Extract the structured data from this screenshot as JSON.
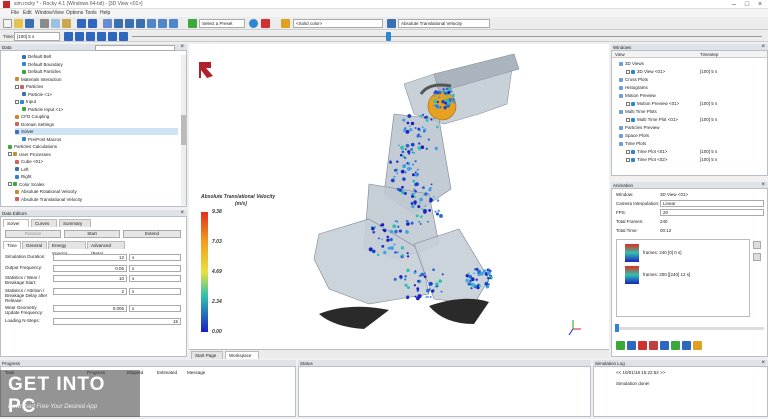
{
  "titlebar": {
    "title": "sim.rocky * - Rocky 4.1 (Windows 64-bit) - [3D View <01>]"
  },
  "menu": [
    "File",
    "Edit",
    "Window",
    "View",
    "Options",
    "Tools",
    "Help"
  ],
  "toolbar": {
    "preset_select": "Select a Preset",
    "color_select": "<Solid color>",
    "property_select": "Absolute Translational Velocity",
    "time_label": "Time:",
    "time_value": "[100] 5 s"
  },
  "data_panel": {
    "title": "Data",
    "tree": [
      {
        "label": "Default Belt",
        "indent": 3,
        "check": false
      },
      {
        "label": "Default Boundary",
        "indent": 3,
        "check": false
      },
      {
        "label": "Default Particles",
        "indent": 3,
        "check": false
      },
      {
        "label": "Materials Interaction",
        "indent": 2,
        "check": false
      },
      {
        "label": "Particles",
        "indent": 2,
        "check": true
      },
      {
        "label": "Particle <1>",
        "indent": 3,
        "check": false
      },
      {
        "label": "Input",
        "indent": 2,
        "check": true
      },
      {
        "label": "Particle Input <1>",
        "indent": 3,
        "check": false
      },
      {
        "label": "CFD Coupling",
        "indent": 2,
        "check": false
      },
      {
        "label": "Domain Settings",
        "indent": 2,
        "check": false
      },
      {
        "label": "Solver",
        "indent": 2,
        "check": false,
        "selected": true
      },
      {
        "label": "Pre/Post Macros",
        "indent": 3,
        "check": false
      },
      {
        "label": "Particles Calculations",
        "indent": 1,
        "check": false
      },
      {
        "label": "User Processes",
        "indent": 1,
        "check": true
      },
      {
        "label": "Cube <01>",
        "indent": 2,
        "check": false
      },
      {
        "label": "Left",
        "indent": 2,
        "check": false
      },
      {
        "label": "Right",
        "indent": 2,
        "check": false
      },
      {
        "label": "Color Scales",
        "indent": 1,
        "check": true
      },
      {
        "label": "Absolute Rotational Velocity",
        "indent": 2,
        "check": false
      },
      {
        "label": "Absolute Translational Velocity",
        "indent": 2,
        "check": false
      }
    ]
  },
  "data_editors": {
    "title": "Data Editors",
    "tabs": [
      "Solver",
      "Curves",
      "Summary"
    ],
    "buttons": [
      "Release",
      "Start",
      "Extend"
    ],
    "subtabs": [
      "Time",
      "General",
      "Energy Spectra",
      "Advanced (Beta)"
    ],
    "fields": [
      {
        "label": "Simulation Duration:",
        "value": "12",
        "unit": "s"
      },
      {
        "label": "Output Frequency:",
        "value": "0.05",
        "unit": "s"
      },
      {
        "label": "Statistics / Wear / Breakage Start:",
        "value": "10",
        "unit": "s"
      },
      {
        "label": "Statistics / Attrition / Breakage Delay after Release:",
        "value": "2",
        "unit": "s"
      },
      {
        "label": "Wear Geometry Update Frequency:",
        "value": "0.005",
        "unit": "s"
      },
      {
        "label": "Loading N-Steps:",
        "value": "15",
        "unit": ""
      }
    ]
  },
  "viewport": {
    "legend_title": "Absolute Translational Velocity",
    "legend_unit": "(m/s)",
    "legend_ticks": [
      "9.38",
      "7.03",
      "4.69",
      "2.34",
      "0.00"
    ],
    "tabs": [
      "Start Page",
      "Workspace"
    ]
  },
  "windows_panel": {
    "title": "Windows",
    "col_view": "View",
    "col_timestep": "Timestep",
    "rows": [
      {
        "label": "3D Views",
        "indent": 1,
        "time": ""
      },
      {
        "label": "3D View <01>",
        "indent": 2,
        "time": "[100] 5 s"
      },
      {
        "label": "Cross Plots",
        "indent": 1,
        "time": ""
      },
      {
        "label": "Histograms",
        "indent": 1,
        "time": ""
      },
      {
        "label": "Motion Preview",
        "indent": 1,
        "time": ""
      },
      {
        "label": "Motion Preview <01>",
        "indent": 2,
        "time": "[100] 5 s"
      },
      {
        "label": "Multi Time Plots",
        "indent": 1,
        "time": ""
      },
      {
        "label": "Multi Time Plot <01>",
        "indent": 2,
        "time": "[100] 5 s"
      },
      {
        "label": "Particles Preview",
        "indent": 1,
        "time": ""
      },
      {
        "label": "Space Plots",
        "indent": 1,
        "time": ""
      },
      {
        "label": "Time Plots",
        "indent": 1,
        "time": ""
      },
      {
        "label": "Time Plot <01>",
        "indent": 2,
        "time": "[100] 5 s"
      },
      {
        "label": "Time Plot <02>",
        "indent": 2,
        "time": "[100] 5 s"
      }
    ]
  },
  "animation_panel": {
    "title": "Animation",
    "fields": [
      {
        "label": "Window:",
        "value": "3D View <01>"
      },
      {
        "label": "Camera Interpolation:",
        "value": "Linear"
      },
      {
        "label": "FPS:",
        "value": "20"
      },
      {
        "label": "Total Frames:",
        "value": "240"
      },
      {
        "label": "Total Time:",
        "value": "00:12"
      }
    ],
    "keyframes": [
      "frames: 240 [0] 0 s]",
      "frames: 200 [[240] 12 s]"
    ]
  },
  "progress_panel": {
    "title": "Progress",
    "cols": [
      "Task",
      "Progress",
      "Elapsed",
      "Estimated",
      "Message"
    ]
  },
  "status_panel": {
    "title": "Status"
  },
  "simlog_panel": {
    "title": "Simulation Log",
    "lines": [
      "<< 10/01/18 15:22:52 >>",
      "Simulation done!"
    ]
  },
  "watermark": {
    "title": "GET INTO PC",
    "subtitle": "Download Free Your Desired App"
  },
  "colors": {
    "accent": "#3a6fb0",
    "legend_top": "#e03020",
    "legend_bottom": "#1a20c0"
  }
}
